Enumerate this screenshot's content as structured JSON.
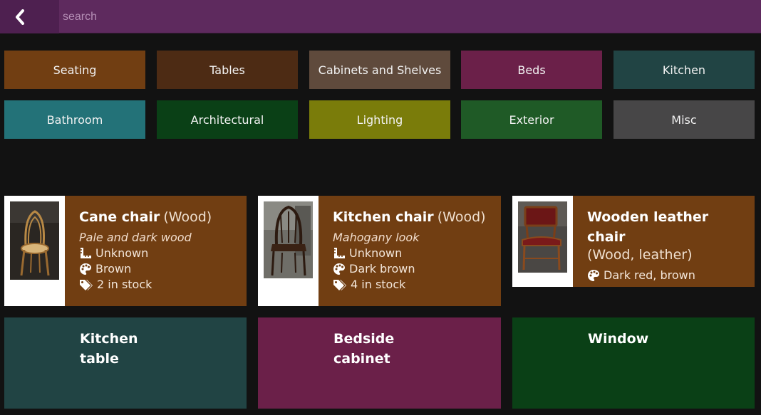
{
  "topbar": {
    "search_placeholder": "search",
    "back_icon": "chevron-left-icon"
  },
  "categories": [
    {
      "label": "Seating",
      "color": "#713e12"
    },
    {
      "label": "Tables",
      "color": "#4d2b14"
    },
    {
      "label": "Cabinets and Shelves",
      "color": "#5f4a3c"
    },
    {
      "label": "Beds",
      "color": "#6b2049"
    },
    {
      "label": "Kitchen",
      "color": "#214444"
    },
    {
      "label": "Bathroom",
      "color": "#237278"
    },
    {
      "label": "Architectural",
      "color": "#0a4016"
    },
    {
      "label": "Lighting",
      "color": "#7a7c0a"
    },
    {
      "label": "Exterior",
      "color": "#1f5a26"
    },
    {
      "label": "Misc",
      "color": "#474647"
    }
  ],
  "items": [
    {
      "name": "Cane chair",
      "material": "(Wood)",
      "description": "Pale and dark wood",
      "size": "Unknown",
      "color": "Brown",
      "stock": "2 in stock"
    },
    {
      "name": "Kitchen chair",
      "material": "(Wood)",
      "description": "Mahogany look",
      "size": "Unknown",
      "color": "Dark brown",
      "stock": "4 in stock"
    },
    {
      "name": "Wooden leather chair",
      "material": "(Wood, leather)",
      "color": "Dark red, brown"
    }
  ],
  "tiles": [
    {
      "title": "Kitchen table",
      "color": "#214444"
    },
    {
      "title": "Bedside cabinet",
      "color": "#6b2049"
    },
    {
      "title": "Window",
      "color": "#0a4016"
    }
  ]
}
